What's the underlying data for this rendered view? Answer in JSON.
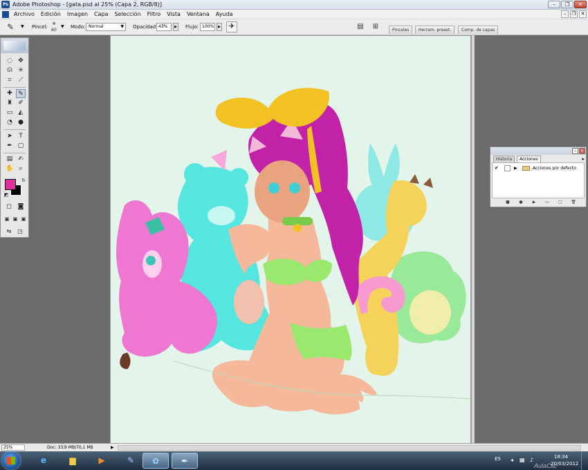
{
  "window": {
    "title": "Adobe Photoshop - [gata.psd al 25% (Capa 2, RGB/8)]",
    "app_icon": "photoshop-icon",
    "controls": [
      "minimize",
      "restore",
      "close"
    ]
  },
  "menu": {
    "items": [
      "Archivo",
      "Edición",
      "Imagen",
      "Capa",
      "Selección",
      "Filtro",
      "Vista",
      "Ventana",
      "Ayuda"
    ]
  },
  "options": {
    "brush_label": "Pincel:",
    "brush_size": "60",
    "mode_label": "Modo:",
    "mode_value": "Normal",
    "opacity_label": "Opacidad:",
    "opacity_value": "43%",
    "flow_label": "Flujo:",
    "flow_value": "100%",
    "well_tabs": [
      "Pinceles",
      "Herram. preest.",
      "Comp. de capas"
    ]
  },
  "tools": {
    "foreground_color": "#e0309a",
    "background_color": "#000000"
  },
  "actions_panel": {
    "tabs": [
      "Historia",
      "Acciones"
    ],
    "active_tab": "Acciones",
    "rows": [
      {
        "checked": true,
        "label": "Acciones por defecto"
      }
    ]
  },
  "status": {
    "zoom": "25%",
    "doc": "Doc: 33,9 MB/70,1 MB"
  },
  "taskbar": {
    "language": "ES",
    "time": "18:34",
    "date": "20/03/2012"
  },
  "watermark": "AulaClic"
}
